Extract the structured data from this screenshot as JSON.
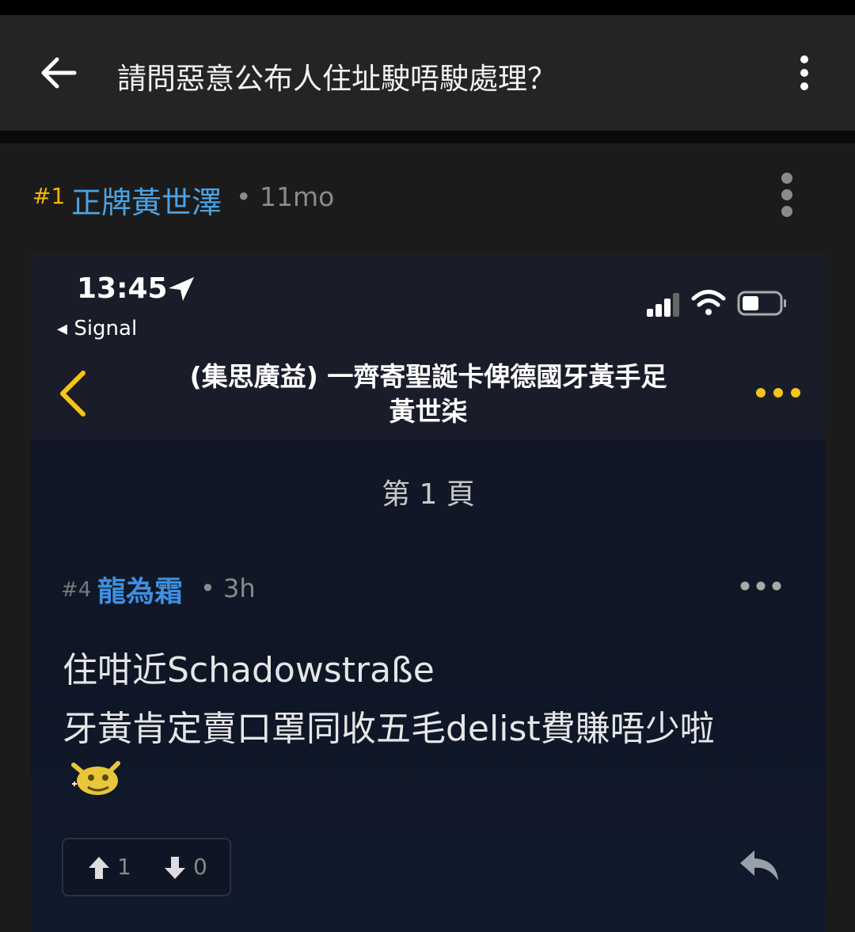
{
  "appbar": {
    "title": "請問惡意公布人住址駛唔駛處理？"
  },
  "post": {
    "number": "#1",
    "username": "正牌黃世澤",
    "time": "• 11mo"
  },
  "embedded": {
    "clock": "13:45",
    "back_app": "◂ Signal",
    "title_line1": "(集思廣益) 一齊寄聖誕卡俾德國牙黃手足",
    "title_line2": "黃世柒",
    "page_label": "第 1 頁",
    "reply": {
      "number": "#4",
      "username": "龍為霜",
      "time": "• 3h",
      "line1": "住咁近Schadowstraße",
      "line2": "牙黃肯定賣口罩同收五毛delist費賺唔少啦",
      "upvotes": "1",
      "downvotes": "0"
    }
  },
  "colors": {
    "accent_blue": "#4aa3e6",
    "post_number": "#f4b400",
    "ios_yellow": "#f5c518"
  },
  "icons": [
    "back-arrow-icon",
    "more-vertical-icon",
    "location-arrow-icon",
    "signal-bars-icon",
    "wifi-icon",
    "battery-icon",
    "chevron-left-icon",
    "more-horizontal-icon",
    "emoji-sticker-icon",
    "thumb-up-arrow-icon",
    "thumb-down-arrow-icon",
    "reply-icon"
  ]
}
